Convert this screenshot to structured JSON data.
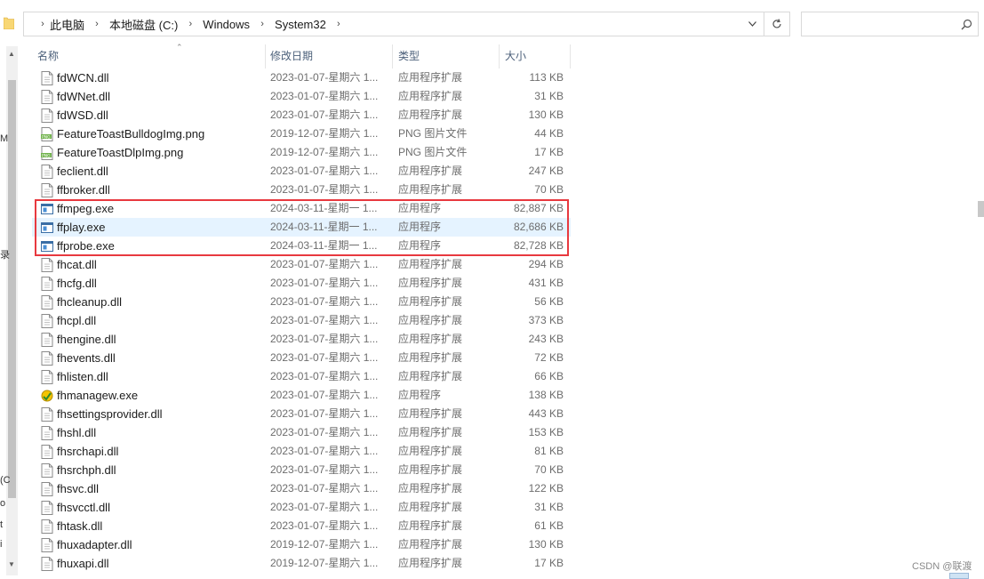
{
  "address_bar": {
    "breadcrumbs": [
      "此电脑",
      "本地磁盘 (C:)",
      "Windows",
      "System32"
    ],
    "search_placeholder": ""
  },
  "icons": {
    "folder": "folder-icon",
    "separator": "chevron-right-icon",
    "dropdown": "chevron-down-icon",
    "refresh": "refresh-icon",
    "search": "search-icon",
    "file": "file-icon",
    "exe": "exe-icon",
    "png": "png-icon"
  },
  "columns": {
    "name": "名称",
    "date": "修改日期",
    "type": "类型",
    "size": "大小"
  },
  "files": [
    {
      "name": "fdWCN.dll",
      "date": "2023-01-07-星期六 1...",
      "type": "应用程序扩展",
      "size": "113 KB",
      "icon": "file"
    },
    {
      "name": "fdWNet.dll",
      "date": "2023-01-07-星期六 1...",
      "type": "应用程序扩展",
      "size": "31 KB",
      "icon": "file"
    },
    {
      "name": "fdWSD.dll",
      "date": "2023-01-07-星期六 1...",
      "type": "应用程序扩展",
      "size": "130 KB",
      "icon": "file"
    },
    {
      "name": "FeatureToastBulldogImg.png",
      "date": "2019-12-07-星期六 1...",
      "type": "PNG 图片文件",
      "size": "44 KB",
      "icon": "png"
    },
    {
      "name": "FeatureToastDlpImg.png",
      "date": "2019-12-07-星期六 1...",
      "type": "PNG 图片文件",
      "size": "17 KB",
      "icon": "png"
    },
    {
      "name": "feclient.dll",
      "date": "2023-01-07-星期六 1...",
      "type": "应用程序扩展",
      "size": "247 KB",
      "icon": "file"
    },
    {
      "name": "ffbroker.dll",
      "date": "2023-01-07-星期六 1...",
      "type": "应用程序扩展",
      "size": "70 KB",
      "icon": "file"
    },
    {
      "name": "ffmpeg.exe",
      "date": "2024-03-11-星期一 1...",
      "type": "应用程序",
      "size": "82,887 KB",
      "icon": "exe"
    },
    {
      "name": "ffplay.exe",
      "date": "2024-03-11-星期一 1...",
      "type": "应用程序",
      "size": "82,686 KB",
      "icon": "exe",
      "selected": true
    },
    {
      "name": "ffprobe.exe",
      "date": "2024-03-11-星期一 1...",
      "type": "应用程序",
      "size": "82,728 KB",
      "icon": "exe"
    },
    {
      "name": "fhcat.dll",
      "date": "2023-01-07-星期六 1...",
      "type": "应用程序扩展",
      "size": "294 KB",
      "icon": "file"
    },
    {
      "name": "fhcfg.dll",
      "date": "2023-01-07-星期六 1...",
      "type": "应用程序扩展",
      "size": "431 KB",
      "icon": "file"
    },
    {
      "name": "fhcleanup.dll",
      "date": "2023-01-07-星期六 1...",
      "type": "应用程序扩展",
      "size": "56 KB",
      "icon": "file"
    },
    {
      "name": "fhcpl.dll",
      "date": "2023-01-07-星期六 1...",
      "type": "应用程序扩展",
      "size": "373 KB",
      "icon": "file"
    },
    {
      "name": "fhengine.dll",
      "date": "2023-01-07-星期六 1...",
      "type": "应用程序扩展",
      "size": "243 KB",
      "icon": "file"
    },
    {
      "name": "fhevents.dll",
      "date": "2023-01-07-星期六 1...",
      "type": "应用程序扩展",
      "size": "72 KB",
      "icon": "file"
    },
    {
      "name": "fhlisten.dll",
      "date": "2023-01-07-星期六 1...",
      "type": "应用程序扩展",
      "size": "66 KB",
      "icon": "file"
    },
    {
      "name": "fhmanagew.exe",
      "date": "2023-01-07-星期六 1...",
      "type": "应用程序",
      "size": "138 KB",
      "icon": "fhmanage"
    },
    {
      "name": "fhsettingsprovider.dll",
      "date": "2023-01-07-星期六 1...",
      "type": "应用程序扩展",
      "size": "443 KB",
      "icon": "file"
    },
    {
      "name": "fhshl.dll",
      "date": "2023-01-07-星期六 1...",
      "type": "应用程序扩展",
      "size": "153 KB",
      "icon": "file"
    },
    {
      "name": "fhsrchapi.dll",
      "date": "2023-01-07-星期六 1...",
      "type": "应用程序扩展",
      "size": "81 KB",
      "icon": "file"
    },
    {
      "name": "fhsrchph.dll",
      "date": "2023-01-07-星期六 1...",
      "type": "应用程序扩展",
      "size": "70 KB",
      "icon": "file"
    },
    {
      "name": "fhsvc.dll",
      "date": "2023-01-07-星期六 1...",
      "type": "应用程序扩展",
      "size": "122 KB",
      "icon": "file"
    },
    {
      "name": "fhsvcctl.dll",
      "date": "2023-01-07-星期六 1...",
      "type": "应用程序扩展",
      "size": "31 KB",
      "icon": "file"
    },
    {
      "name": "fhtask.dll",
      "date": "2023-01-07-星期六 1...",
      "type": "应用程序扩展",
      "size": "61 KB",
      "icon": "file"
    },
    {
      "name": "fhuxadapter.dll",
      "date": "2019-12-07-星期六 1...",
      "type": "应用程序扩展",
      "size": "130 KB",
      "icon": "file"
    },
    {
      "name": "fhuxapi.dll",
      "date": "2019-12-07-星期六 1...",
      "type": "应用程序扩展",
      "size": "17 KB",
      "icon": "file"
    }
  ],
  "highlight": {
    "color": "#e8393f"
  },
  "selection_color": "#e5f3ff",
  "watermark": "CSDN @联渡",
  "nav_fragments": [
    "M",
    "录",
    "(C",
    "o",
    "t",
    "i"
  ]
}
